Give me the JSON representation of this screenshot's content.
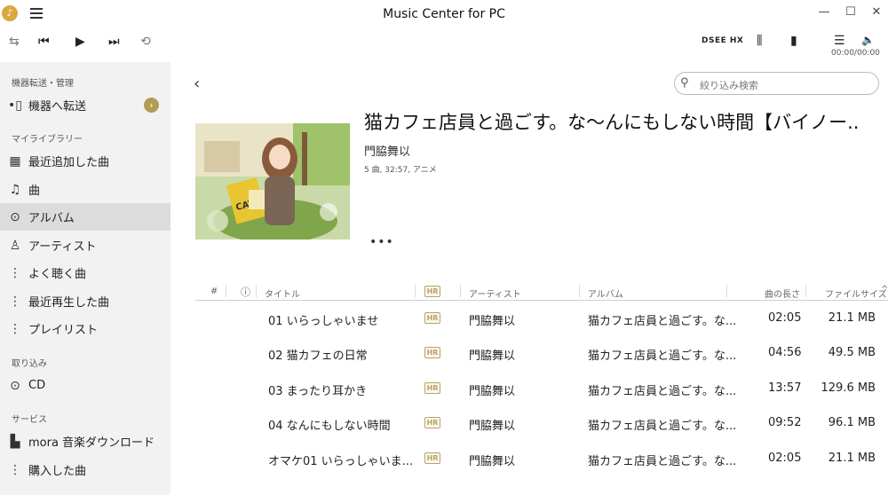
{
  "window": {
    "title": "Music Center for PC",
    "minimize": "—",
    "maximize": "☐",
    "close": "✕"
  },
  "toolbar": {
    "repeat_icon": "⇆",
    "prev_icon": "⏮",
    "play_icon": "▶",
    "next_icon": "⏭",
    "shuffle_icon": "⟲",
    "dsee_label": "DSEE HX",
    "eq_icon": "⫼",
    "speaker_icon": "▮",
    "queue_icon": "☰",
    "volume_icon": "🔈",
    "time": "00:00/00:00"
  },
  "sidebar": {
    "section_device": "機器転送・管理",
    "device_transfer": "機器へ転送",
    "section_library": "マイライブラリー",
    "recent_added": "最近追加した曲",
    "songs": "曲",
    "albums": "アルバム",
    "artists": "アーティスト",
    "frequent": "よく聴く曲",
    "recent_played": "最近再生した曲",
    "playlists": "プレイリスト",
    "section_import": "取り込み",
    "cd": "CD",
    "section_services": "サービス",
    "mora": "mora 音楽ダウンロード",
    "purchased": "購入した曲"
  },
  "search": {
    "placeholder": "絞り込み検索"
  },
  "album": {
    "title": "猫カフェ店員と過ごす。な〜んにもしない時間【バイノー..",
    "artist": "門脇舞以",
    "meta": "5 曲, 32:57, アニメ",
    "more": "•••"
  },
  "table": {
    "headers": {
      "num": "#",
      "info": "ⓘ",
      "title": "タイトル",
      "hr": "HR",
      "artist": "アーティスト",
      "album": "アルバム",
      "length": "曲の長さ",
      "size": "ファイルサイズ",
      "sort": "^"
    },
    "rows": [
      {
        "title": "01 いらっしゃいませ",
        "hr": "HR",
        "artist": "門脇舞以",
        "album": "猫カフェ店員と過ごす。な...",
        "length": "02:05",
        "size": "21.1 MB"
      },
      {
        "title": "02 猫カフェの日常",
        "hr": "HR",
        "artist": "門脇舞以",
        "album": "猫カフェ店員と過ごす。な...",
        "length": "04:56",
        "size": "49.5 MB"
      },
      {
        "title": "03 まったり耳かき",
        "hr": "HR",
        "artist": "門脇舞以",
        "album": "猫カフェ店員と過ごす。な...",
        "length": "13:57",
        "size": "129.6 MB"
      },
      {
        "title": "04 なんにもしない時間",
        "hr": "HR",
        "artist": "門脇舞以",
        "album": "猫カフェ店員と過ごす。な...",
        "length": "09:52",
        "size": "96.1 MB"
      },
      {
        "title": "オマケ01 いらっしゃいま...",
        "hr": "HR",
        "artist": "門脇舞以",
        "album": "猫カフェ店員と過ごす。な...",
        "length": "02:05",
        "size": "21.1 MB"
      }
    ]
  },
  "colors": {
    "sidebar_bg": "#f2f2f2",
    "active_item": "#dcdcdc",
    "accent": "#b39a55"
  }
}
